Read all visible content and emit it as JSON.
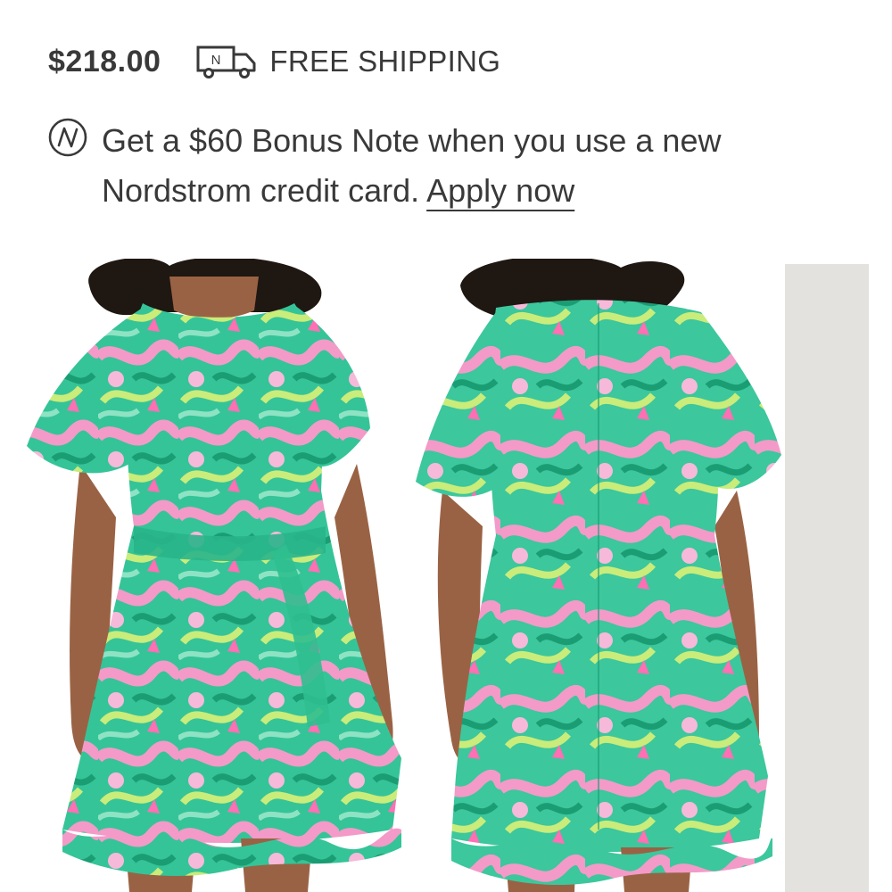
{
  "product": {
    "price": "$218.00",
    "shipping_label": "FREE SHIPPING",
    "shipping_icon": "delivery-truck-icon",
    "truck_icon_letter": "N"
  },
  "promo": {
    "icon": "nordstrom-note-icon",
    "text_prefix": "Get a $60 Bonus Note when you use a new Nordstrom credit card.",
    "link_label": "Apply now"
  },
  "gallery": {
    "images": [
      {
        "view": "front"
      },
      {
        "view": "back"
      },
      {
        "view": "partial"
      }
    ]
  },
  "colors": {
    "text": "#393939",
    "dress_green": "#2fbf8f",
    "dress_pink": "#f39ac8",
    "dress_lime": "#c9ec7a",
    "skin": "#9a6244",
    "hair": "#1f1712"
  }
}
